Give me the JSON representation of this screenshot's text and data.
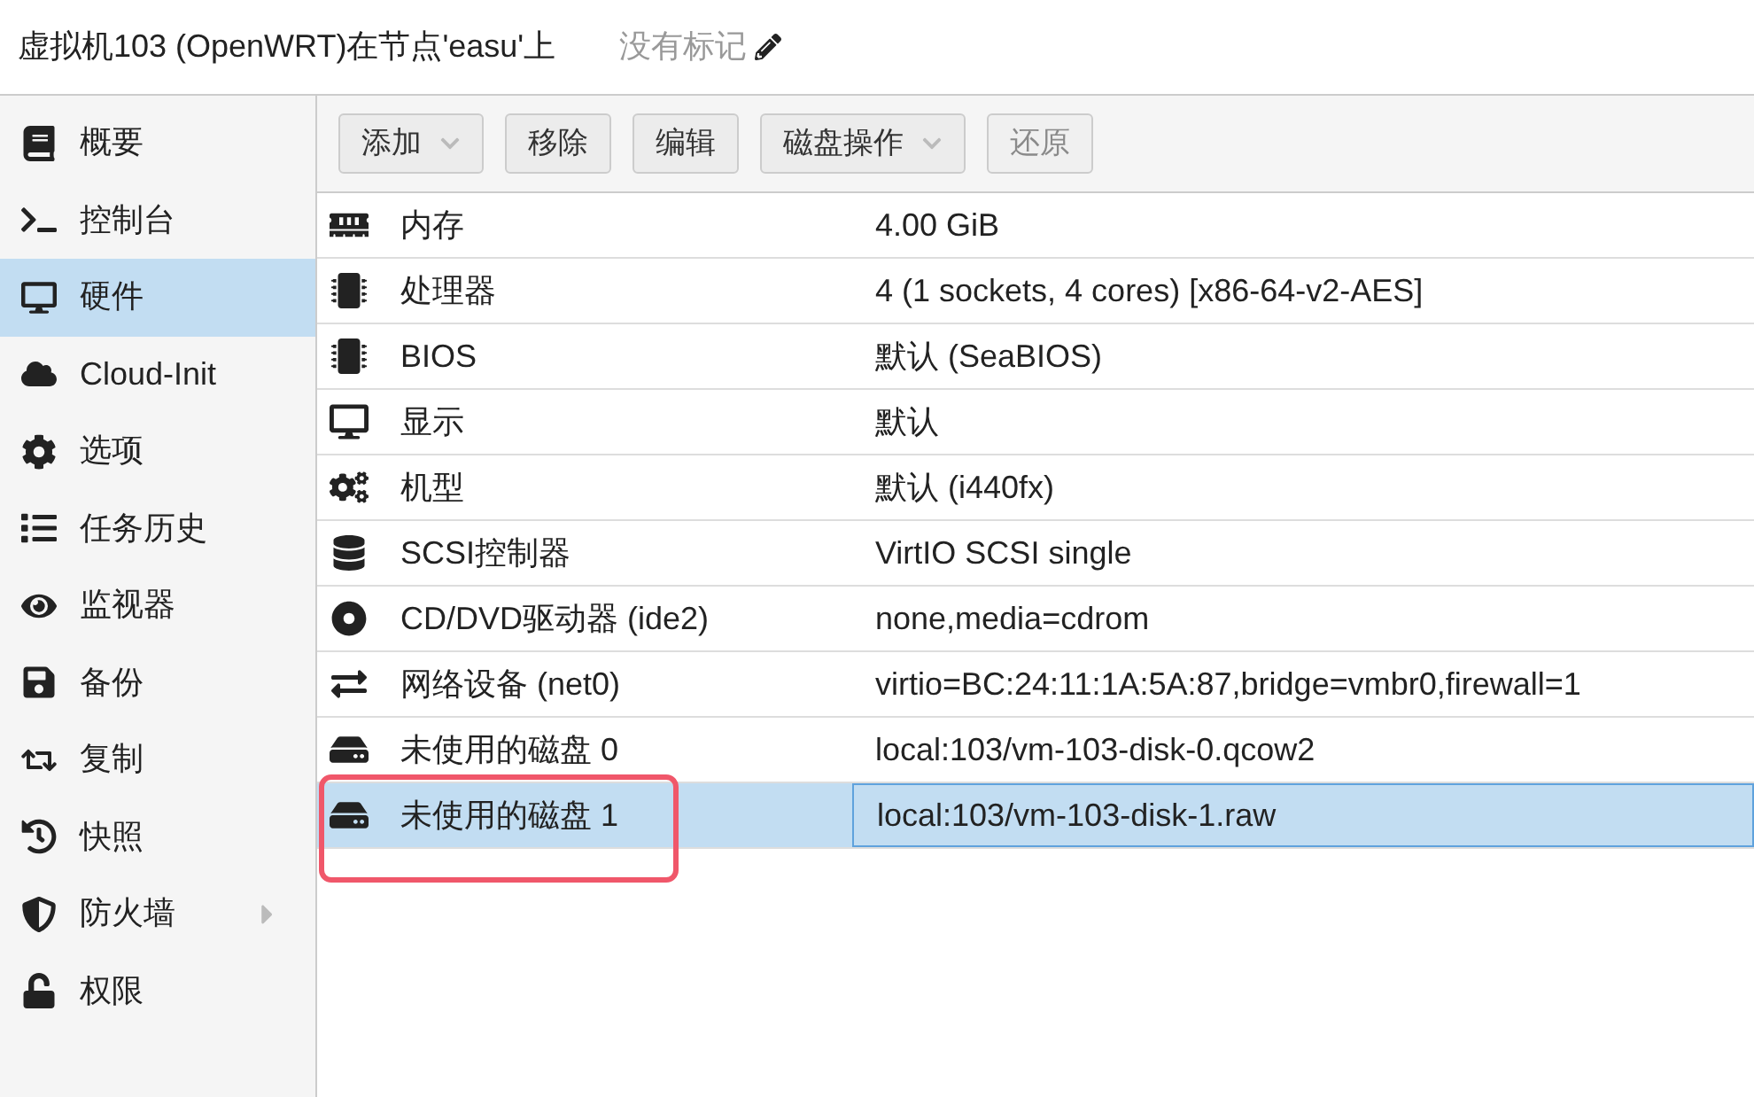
{
  "header": {
    "title": "虚拟机103 (OpenWRT)在节点'easu'上",
    "tags": "没有标记"
  },
  "sidebar": {
    "items": [
      {
        "label": "概要",
        "selected": false,
        "has_submenu": false
      },
      {
        "label": "控制台",
        "selected": false,
        "has_submenu": false
      },
      {
        "label": "硬件",
        "selected": true,
        "has_submenu": false
      },
      {
        "label": "Cloud-Init",
        "selected": false,
        "has_submenu": false
      },
      {
        "label": "选项",
        "selected": false,
        "has_submenu": false
      },
      {
        "label": "任务历史",
        "selected": false,
        "has_submenu": false
      },
      {
        "label": "监视器",
        "selected": false,
        "has_submenu": false
      },
      {
        "label": "备份",
        "selected": false,
        "has_submenu": false
      },
      {
        "label": "复制",
        "selected": false,
        "has_submenu": false
      },
      {
        "label": "快照",
        "selected": false,
        "has_submenu": false
      },
      {
        "label": "防火墙",
        "selected": false,
        "has_submenu": true
      },
      {
        "label": "权限",
        "selected": false,
        "has_submenu": false
      }
    ]
  },
  "toolbar": [
    {
      "label": "添加",
      "dropdown": true,
      "disabled": false
    },
    {
      "label": "移除",
      "dropdown": false,
      "disabled": false
    },
    {
      "label": "编辑",
      "dropdown": false,
      "disabled": false
    },
    {
      "label": "磁盘操作",
      "dropdown": true,
      "disabled": false
    },
    {
      "label": "还原",
      "dropdown": false,
      "disabled": true
    }
  ],
  "table": {
    "rows": [
      {
        "name": "内存",
        "value": "4.00 GiB",
        "selected": false,
        "highlighted": false
      },
      {
        "name": "处理器",
        "value": "4 (1 sockets, 4 cores) [x86-64-v2-AES]",
        "selected": false,
        "highlighted": false
      },
      {
        "name": "BIOS",
        "value": "默认 (SeaBIOS)",
        "selected": false,
        "highlighted": false
      },
      {
        "name": "显示",
        "value": "默认",
        "selected": false,
        "highlighted": false
      },
      {
        "name": "机型",
        "value": "默认 (i440fx)",
        "selected": false,
        "highlighted": false
      },
      {
        "name": "SCSI控制器",
        "value": "VirtIO SCSI single",
        "selected": false,
        "highlighted": false
      },
      {
        "name": "CD/DVD驱动器 (ide2)",
        "value": "none,media=cdrom",
        "selected": false,
        "highlighted": false
      },
      {
        "name": "网络设备 (net0)",
        "value": "virtio=BC:24:11:1A:5A:87,bridge=vmbr0,firewall=1",
        "selected": false,
        "highlighted": false
      },
      {
        "name": "未使用的磁盘 0",
        "value": "local:103/vm-103-disk-0.qcow2",
        "selected": false,
        "highlighted": false
      },
      {
        "name": "未使用的磁盘 1",
        "value": "local:103/vm-103-disk-1.raw",
        "selected": true,
        "highlighted": true
      }
    ]
  }
}
